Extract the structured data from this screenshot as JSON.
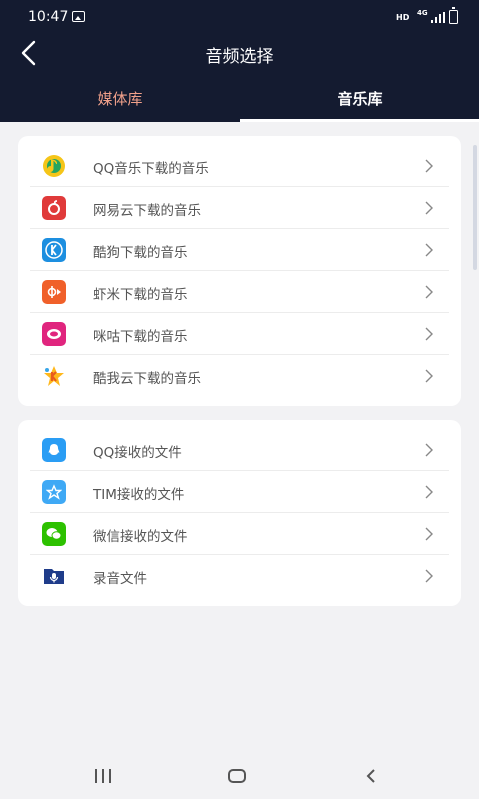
{
  "status_bar": {
    "time": "10:47",
    "hd": "HD",
    "network": "4G"
  },
  "header": {
    "title": "音频选择"
  },
  "tabs": [
    {
      "label": "媒体库",
      "active": false
    },
    {
      "label": "音乐库",
      "active": true
    }
  ],
  "music_apps": [
    {
      "label": "QQ音乐下载的音乐",
      "icon": "qq-music-icon"
    },
    {
      "label": "网易云下载的音乐",
      "icon": "netease-cloud-music-icon"
    },
    {
      "label": "酷狗下载的音乐",
      "icon": "kugou-icon"
    },
    {
      "label": "虾米下载的音乐",
      "icon": "xiami-icon"
    },
    {
      "label": "咪咕下载的音乐",
      "icon": "migu-icon"
    },
    {
      "label": "酷我云下载的音乐",
      "icon": "kuwo-icon"
    }
  ],
  "file_sources": [
    {
      "label": "QQ接收的文件",
      "icon": "qq-icon"
    },
    {
      "label": "TIM接收的文件",
      "icon": "tim-icon"
    },
    {
      "label": "微信接收的文件",
      "icon": "wechat-icon"
    },
    {
      "label": "录音文件",
      "icon": "recording-folder-icon"
    }
  ],
  "colors": {
    "header_bg": "#141b30",
    "accent_tab": "#f0a08a",
    "page_bg": "#f2f2f4"
  }
}
